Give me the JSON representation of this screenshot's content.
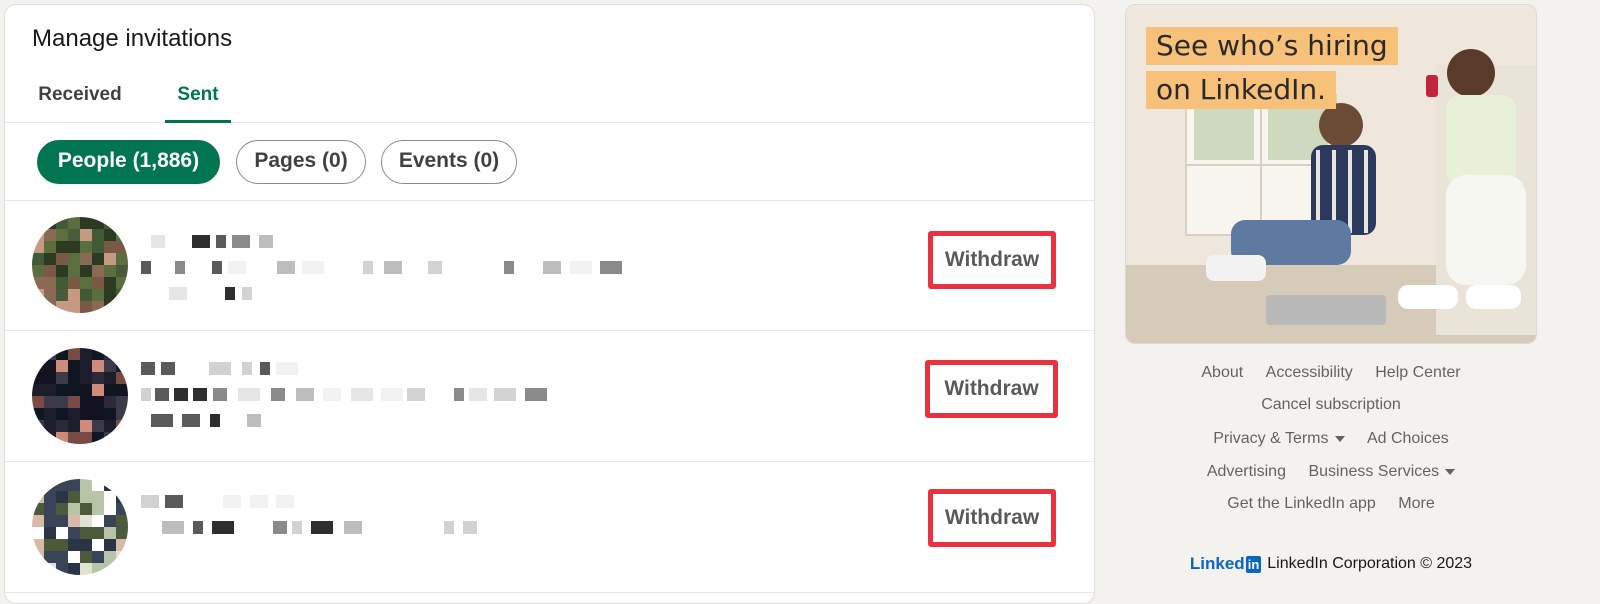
{
  "card": {
    "title": "Manage invitations"
  },
  "tabs": [
    {
      "label": "Received"
    },
    {
      "label": "Sent"
    }
  ],
  "filters": [
    {
      "label": "People (1,886)"
    },
    {
      "label": "Pages (0)"
    },
    {
      "label": "Events (0)"
    }
  ],
  "invitations": [
    {
      "action": "Withdraw"
    },
    {
      "action": "Withdraw"
    },
    {
      "action": "Withdraw"
    }
  ],
  "ad": {
    "line1": "See who’s hiring",
    "line2": "on LinkedIn."
  },
  "footer": {
    "links": {
      "about": "About",
      "accessibility": "Accessibility",
      "help_center": "Help Center",
      "cancel_subscription": "Cancel subscription",
      "privacy_terms": "Privacy & Terms",
      "ad_choices": "Ad Choices",
      "advertising": "Advertising",
      "business_services": "Business Services",
      "get_app": "Get the LinkedIn app",
      "more": "More"
    },
    "logo_word": "Linked",
    "logo_box": "in",
    "copyright": "LinkedIn Corporation © 2023"
  },
  "colors": {
    "accent_green": "#01754f",
    "highlight_red": "#e8323f",
    "linkedin_blue": "#0a66c2",
    "ad_yellow": "#f7c17a",
    "page_bg": "#f4f2ee"
  }
}
